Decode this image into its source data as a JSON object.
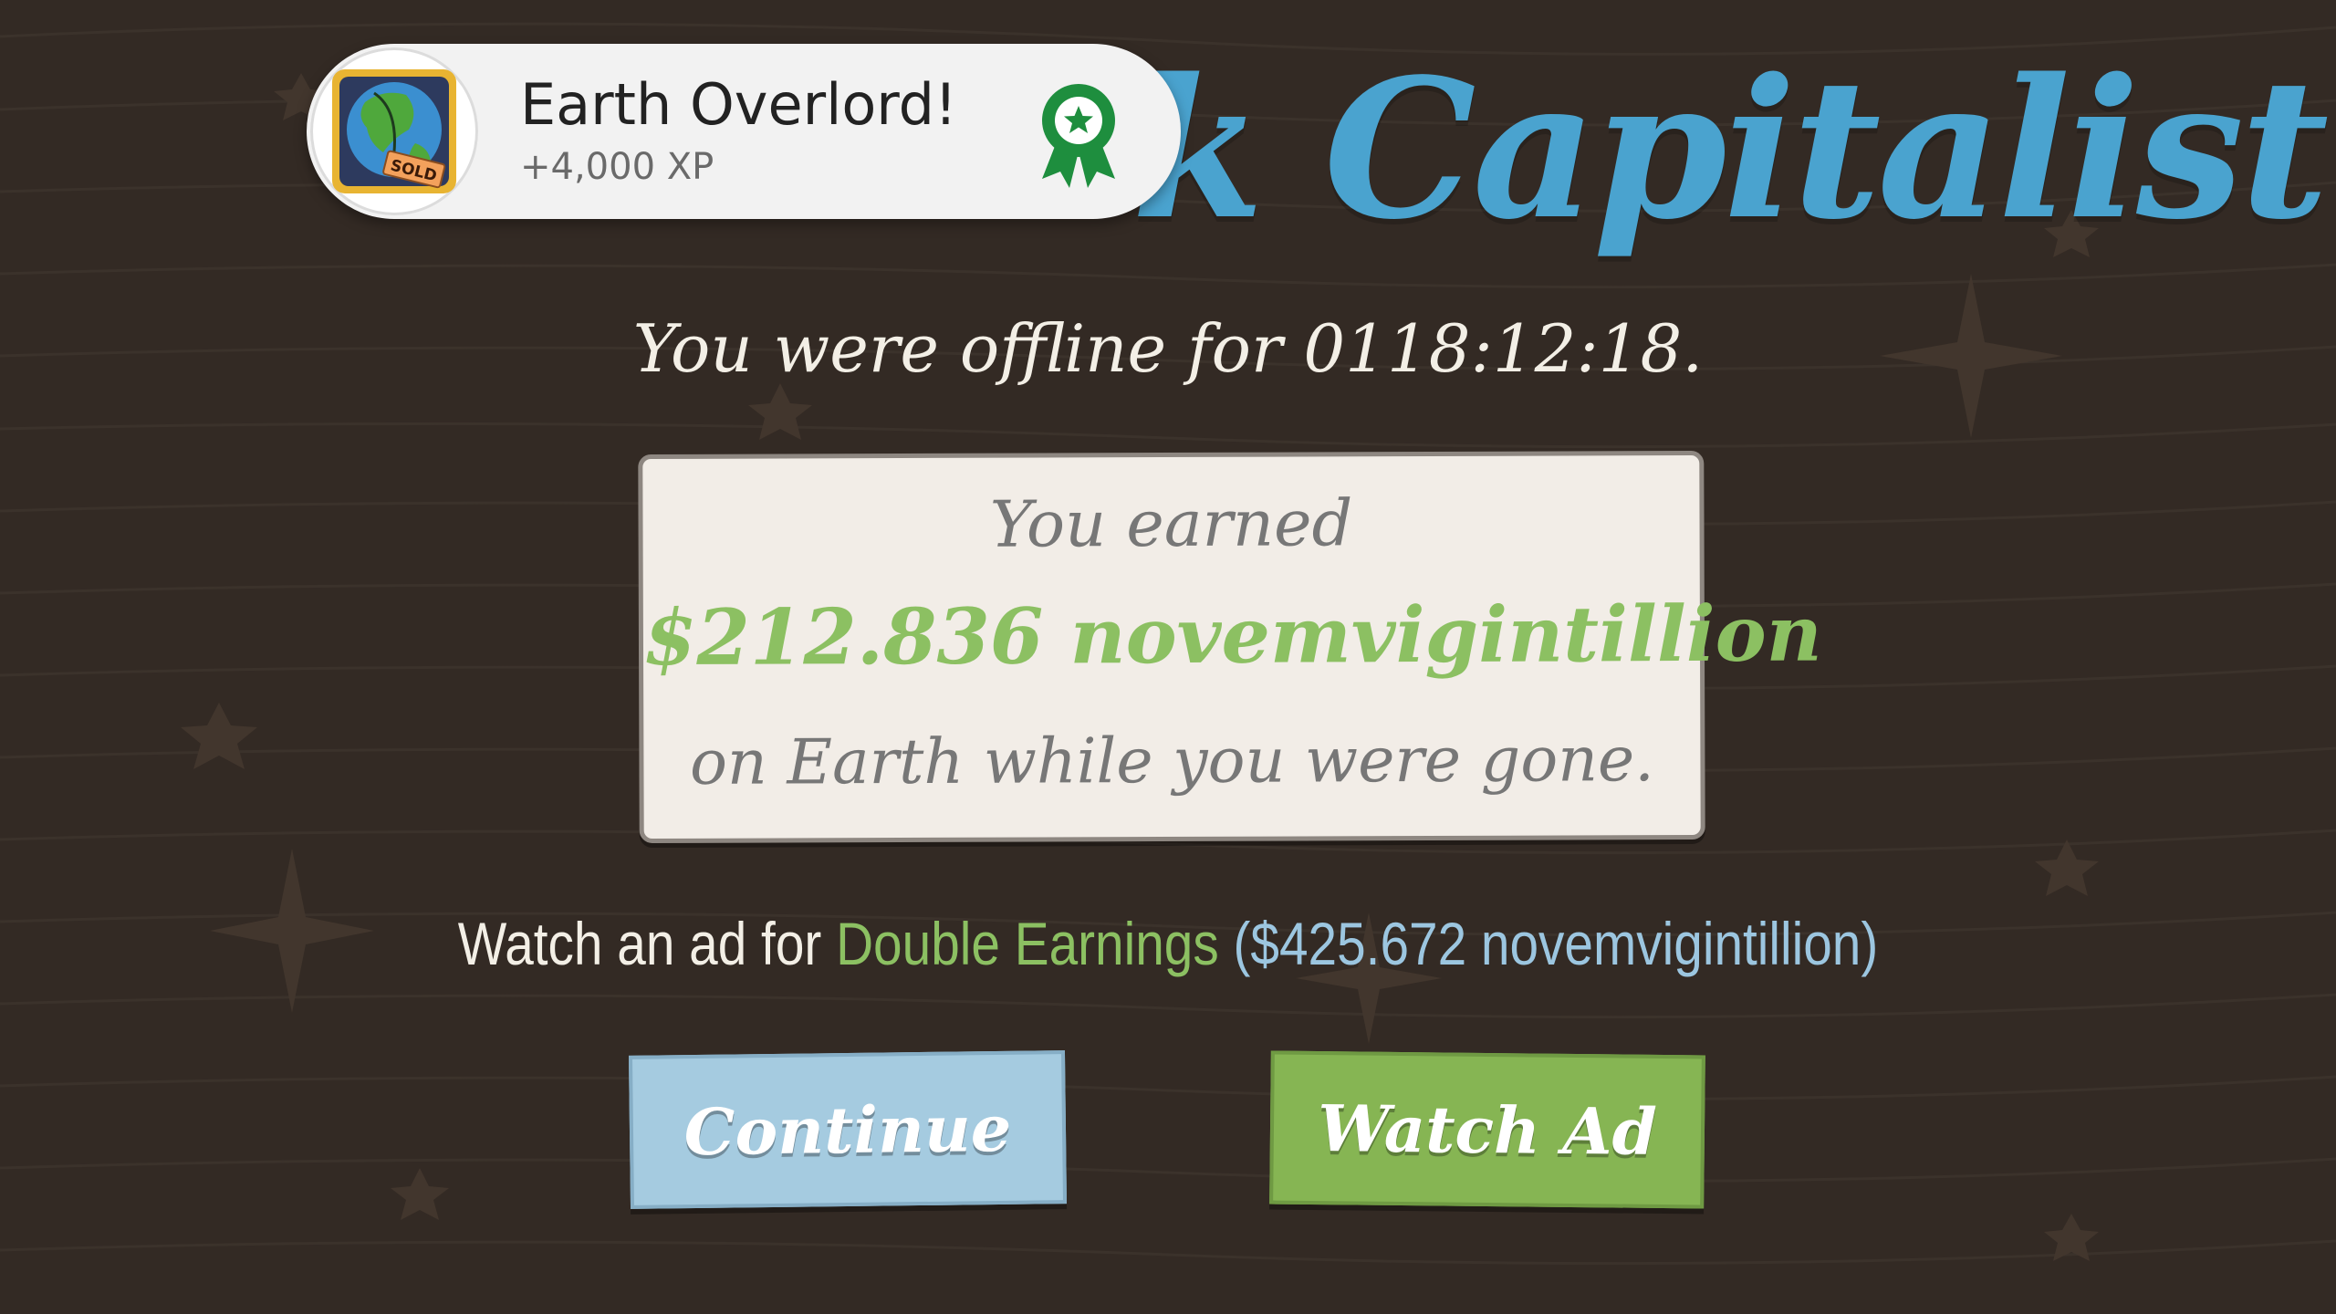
{
  "game": {
    "title_fragment": "k Capitalist!"
  },
  "achievement_toast": {
    "title": "Earth Overlord!",
    "xp": "+4,000 XP",
    "badge_icon": "earth-sold-icon",
    "badge_sign_text": "SOLD",
    "ribbon_icon": "achievement-ribbon-icon"
  },
  "offline": {
    "message": "You were offline for 0118:12:18."
  },
  "earnings": {
    "line1": "You earned",
    "amount": "$212.836 novemvigintillion",
    "line3": "on Earth while you were gone."
  },
  "ad_offer": {
    "prefix": "Watch an ad for ",
    "highlight": "Double Earnings",
    "amount": " ($425.672 novemvigintillion)"
  },
  "buttons": {
    "continue": "Continue",
    "watch_ad": "Watch Ad"
  },
  "colors": {
    "background": "#332a24",
    "title_blue": "#4aa3cf",
    "money_green": "#8cc062",
    "continue_button": "#a5cbe0",
    "watch_ad_button": "#86b553"
  }
}
